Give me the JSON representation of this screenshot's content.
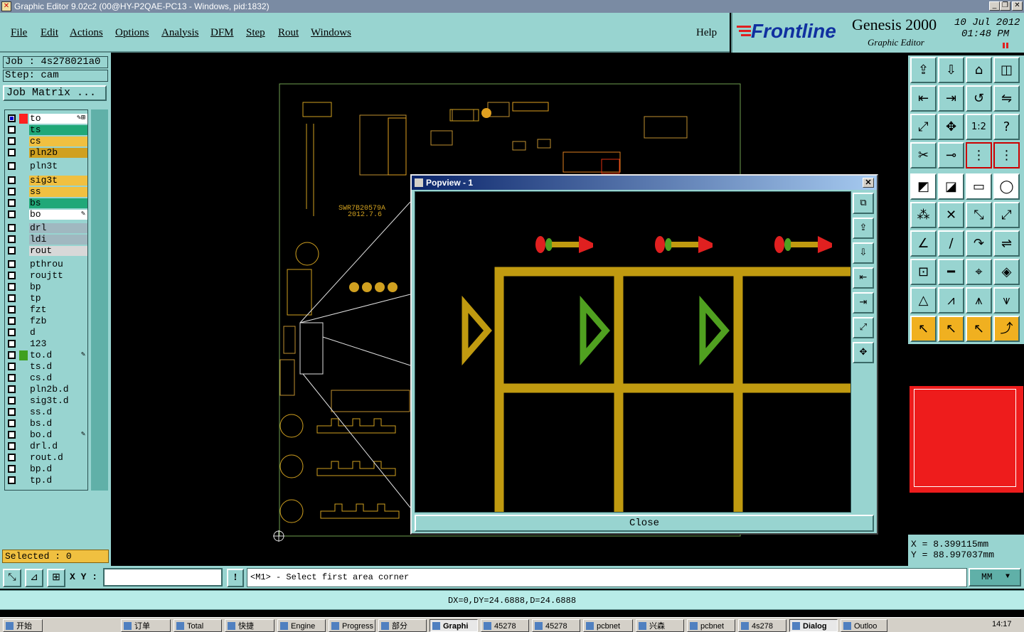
{
  "window": {
    "title": "Graphic Editor 9.02c2 (00@HY-P2QAE-PC13 - Windows, pid:1832)"
  },
  "menu": [
    "File",
    "Edit",
    "Actions",
    "Options",
    "Analysis",
    "DFM",
    "Step",
    "Rout",
    "Windows"
  ],
  "help_label": "Help",
  "brand": {
    "logo": "Frontline",
    "product": "Genesis 2000",
    "subtitle": "Graphic Editor",
    "date": "10 Jul 2012",
    "time": "01:48 PM"
  },
  "job": {
    "job_label": "Job : 4s278021a0",
    "step_label": "Step: cam",
    "matrix_button": "Job Matrix ..."
  },
  "layers": [
    {
      "name": "to",
      "color": "#ffffff",
      "swatch": "#ff2020",
      "checked": true,
      "mark": "✎⊞"
    },
    {
      "name": "ts",
      "color": "#20a878",
      "swatch": "",
      "checked": false,
      "mark": ""
    },
    {
      "name": "cs",
      "color": "#f0c040",
      "swatch": "",
      "checked": false,
      "mark": ""
    },
    {
      "name": "pln2b",
      "color": "#d0a020",
      "swatch": "",
      "checked": false,
      "mark": ""
    },
    {
      "name": "pln3t",
      "color": "#98d4d0",
      "swatch": "",
      "checked": false,
      "mark": ""
    },
    {
      "name": "sig3t",
      "color": "#f0c040",
      "swatch": "",
      "checked": false,
      "mark": ""
    },
    {
      "name": "ss",
      "color": "#f0c040",
      "swatch": "",
      "checked": false,
      "mark": ""
    },
    {
      "name": "bs",
      "color": "#20a878",
      "swatch": "",
      "checked": false,
      "mark": ""
    },
    {
      "name": "bo",
      "color": "#ffffff",
      "swatch": "",
      "checked": false,
      "mark": "✎"
    },
    {
      "name": "drl",
      "color": "#a0b8c0",
      "swatch": "",
      "checked": false,
      "mark": ""
    },
    {
      "name": "ldi",
      "color": "#a0b8c0",
      "swatch": "",
      "checked": false,
      "mark": ""
    },
    {
      "name": "rout",
      "color": "#d8d8d8",
      "swatch": "",
      "checked": false,
      "mark": ""
    },
    {
      "name": "pthrou",
      "color": "#98d4d0",
      "swatch": "",
      "checked": false,
      "mark": ""
    },
    {
      "name": "roujtt",
      "color": "#98d4d0",
      "swatch": "",
      "checked": false,
      "mark": ""
    },
    {
      "name": "bp",
      "color": "#98d4d0",
      "swatch": "",
      "checked": false,
      "mark": ""
    },
    {
      "name": "tp",
      "color": "#98d4d0",
      "swatch": "",
      "checked": false,
      "mark": ""
    },
    {
      "name": "fzt",
      "color": "#98d4d0",
      "swatch": "",
      "checked": false,
      "mark": ""
    },
    {
      "name": "fzb",
      "color": "#98d4d0",
      "swatch": "",
      "checked": false,
      "mark": ""
    },
    {
      "name": "d",
      "color": "#98d4d0",
      "swatch": "",
      "checked": false,
      "mark": ""
    },
    {
      "name": "123",
      "color": "#98d4d0",
      "swatch": "",
      "checked": false,
      "mark": ""
    },
    {
      "name": "to.d",
      "color": "#98d4d0",
      "swatch": "#40a020",
      "checked": false,
      "mark": "✎"
    },
    {
      "name": "ts.d",
      "color": "#98d4d0",
      "swatch": "",
      "checked": false,
      "mark": ""
    },
    {
      "name": "cs.d",
      "color": "#98d4d0",
      "swatch": "",
      "checked": false,
      "mark": ""
    },
    {
      "name": "pln2b.d",
      "color": "#98d4d0",
      "swatch": "",
      "checked": false,
      "mark": ""
    },
    {
      "name": "sig3t.d",
      "color": "#98d4d0",
      "swatch": "",
      "checked": false,
      "mark": ""
    },
    {
      "name": "ss.d",
      "color": "#98d4d0",
      "swatch": "",
      "checked": false,
      "mark": ""
    },
    {
      "name": "bs.d",
      "color": "#98d4d0",
      "swatch": "",
      "checked": false,
      "mark": ""
    },
    {
      "name": "bo.d",
      "color": "#98d4d0",
      "swatch": "",
      "checked": false,
      "mark": "✎"
    },
    {
      "name": "drl.d",
      "color": "#98d4d0",
      "swatch": "",
      "checked": false,
      "mark": ""
    },
    {
      "name": "rout.d",
      "color": "#98d4d0",
      "swatch": "",
      "checked": false,
      "mark": ""
    },
    {
      "name": "bp.d",
      "color": "#98d4d0",
      "swatch": "",
      "checked": false,
      "mark": ""
    },
    {
      "name": "tp.d",
      "color": "#98d4d0",
      "swatch": "",
      "checked": false,
      "mark": ""
    }
  ],
  "selected_label": "Selected : 0",
  "board": {
    "text1": "SWR7B20579A",
    "text2": "2012.7.6"
  },
  "popview": {
    "title": "Popview - 1",
    "close_label": "Close"
  },
  "tools": [
    [
      "⇪",
      "⇩",
      "⌂",
      "◫"
    ],
    [
      "⇤",
      "⇥",
      "↺",
      "⇋"
    ],
    [
      "⤢",
      "✥",
      "1:2",
      "?"
    ],
    [
      "✂",
      "⊸",
      "⋮",
      "⋮"
    ],
    [
      "◩",
      "◪",
      "▭",
      "◯"
    ],
    [
      "⁂",
      "✕",
      "⤡",
      "⤢"
    ],
    [
      "∠",
      "∕",
      "↷",
      "⇌"
    ],
    [
      "⊡",
      "━",
      "⌖",
      "◈"
    ],
    [
      "△",
      "⩘",
      "⩚",
      "⩛"
    ],
    [
      "↖",
      "↖",
      "↖",
      "⤴"
    ]
  ],
  "coords": {
    "x": "X = 8.399115mm",
    "y": "Y = 88.997037mm"
  },
  "cmd": {
    "xy_label": "X Y :",
    "xy_value": "",
    "message": "<M1> - Select first area corner",
    "units": "MM"
  },
  "status": "DX=0,DY=24.6888,D=24.6888",
  "taskbar": [
    {
      "label": "开始",
      "active": false
    },
    {
      "label": "订单",
      "active": false
    },
    {
      "label": "Total",
      "active": false
    },
    {
      "label": "快捷",
      "active": false
    },
    {
      "label": "Engine",
      "active": false
    },
    {
      "label": "Progress",
      "active": false
    },
    {
      "label": "部分",
      "active": false
    },
    {
      "label": "Graphi",
      "active": true
    },
    {
      "label": "45278",
      "active": false
    },
    {
      "label": "45278",
      "active": false
    },
    {
      "label": "pcbnet",
      "active": false
    },
    {
      "label": "兴森",
      "active": false
    },
    {
      "label": "pcbnet",
      "active": false
    },
    {
      "label": "4s278",
      "active": false
    },
    {
      "label": "Dialog",
      "active": true
    },
    {
      "label": "Outloo",
      "active": false
    }
  ],
  "clock": "14:17"
}
